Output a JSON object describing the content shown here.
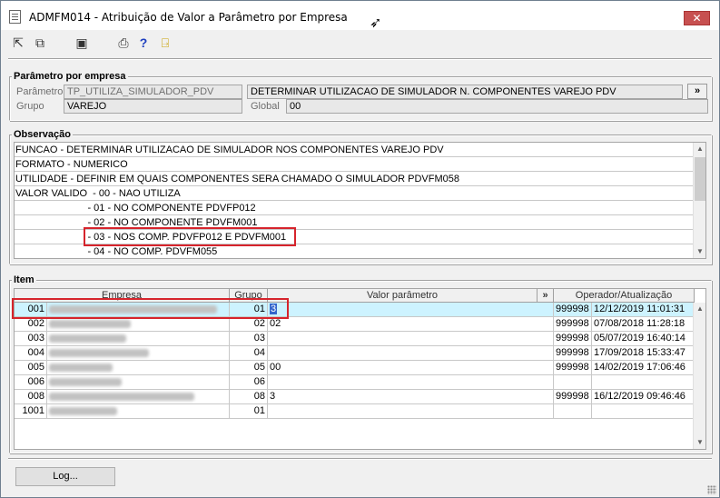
{
  "window": {
    "title": "ADMFM014 - Atribuição de Valor a Parâmetro por Empresa",
    "close": "✕"
  },
  "param_group": {
    "legend": "Parâmetro por empresa",
    "parametro_label": "Parâmetro",
    "parametro_value": "TP_UTILIZA_SIMULADOR_PDV",
    "descricao_value": "DETERMINAR UTILIZACAO DE SIMULADOR N. COMPONENTES VAREJO PDV",
    "more_label": "»",
    "grupo_label": "Grupo",
    "grupo_value": "VAREJO",
    "global_label": "Global",
    "global_value": "00"
  },
  "observacao": {
    "legend": "Observação",
    "lines": [
      "FUNCAO - DETERMINAR UTILIZACAO DE SIMULADOR NOS COMPONENTES VAREJO PDV",
      "FORMATO - NUMERICO",
      "UTILIDADE - DEFINIR EM QUAIS COMPONENTES SERA CHAMADO O SIMULADOR PDVFM058",
      "VALOR VALIDO  - 00 - NAO UTILIZA",
      "                          - 01 - NO COMPONENTE PDVFP012",
      "                          - 02 - NO COMPONENTE PDVFM001",
      "                          - 03 - NOS COMP. PDVFP012 E PDVFM001",
      "                          - 04 - NO COMP. PDVFM055"
    ]
  },
  "item": {
    "legend": "Item",
    "headers": {
      "empresa": "Empresa",
      "grupo": "Grupo",
      "valor": "Valor parâmetro",
      "more": "»",
      "operador": "Operador/Atualização"
    },
    "rows": [
      {
        "code": "001",
        "grupo": "01",
        "valor": "3",
        "operador": "999998",
        "data": "12/12/2019 11:01:31"
      },
      {
        "code": "002",
        "grupo": "02",
        "valor": "02",
        "operador": "999998",
        "data": "07/08/2018 11:28:18"
      },
      {
        "code": "003",
        "grupo": "03",
        "valor": "",
        "operador": "999998",
        "data": "05/07/2019 16:40:14"
      },
      {
        "code": "004",
        "grupo": "04",
        "valor": "",
        "operador": "999998",
        "data": "17/09/2018 15:33:47"
      },
      {
        "code": "005",
        "grupo": "05",
        "valor": "00",
        "operador": "999998",
        "data": "14/02/2019 17:06:46"
      },
      {
        "code": "006",
        "grupo": "06",
        "valor": "",
        "operador": "",
        "data": ""
      },
      {
        "code": "008",
        "grupo": "08",
        "valor": "3",
        "operador": "999998",
        "data": "16/12/2019 09:46:46"
      },
      {
        "code": "1001",
        "grupo": "01",
        "valor": "",
        "operador": "",
        "data": ""
      }
    ]
  },
  "log_button": "Log..."
}
